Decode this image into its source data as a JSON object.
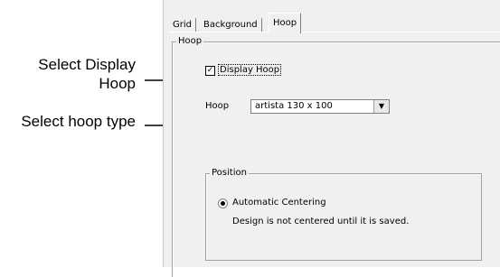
{
  "callouts": {
    "display_hoop": "Select Display Hoop",
    "hoop_type": "Select hoop type"
  },
  "tabs": [
    {
      "label": "Grid",
      "active": false
    },
    {
      "label": "Background",
      "active": false
    },
    {
      "label": "Hoop",
      "active": true
    }
  ],
  "hoop_group": {
    "title": "Hoop",
    "display_hoop": {
      "label": "Display Hoop",
      "checked": true
    },
    "hoop_field": {
      "label": "Hoop",
      "value": "artista 130 x 100"
    }
  },
  "position_group": {
    "title": "Position",
    "automatic_centering": {
      "label": "Automatic Centering",
      "selected": true
    },
    "note": "Design is not centered until it is saved."
  }
}
